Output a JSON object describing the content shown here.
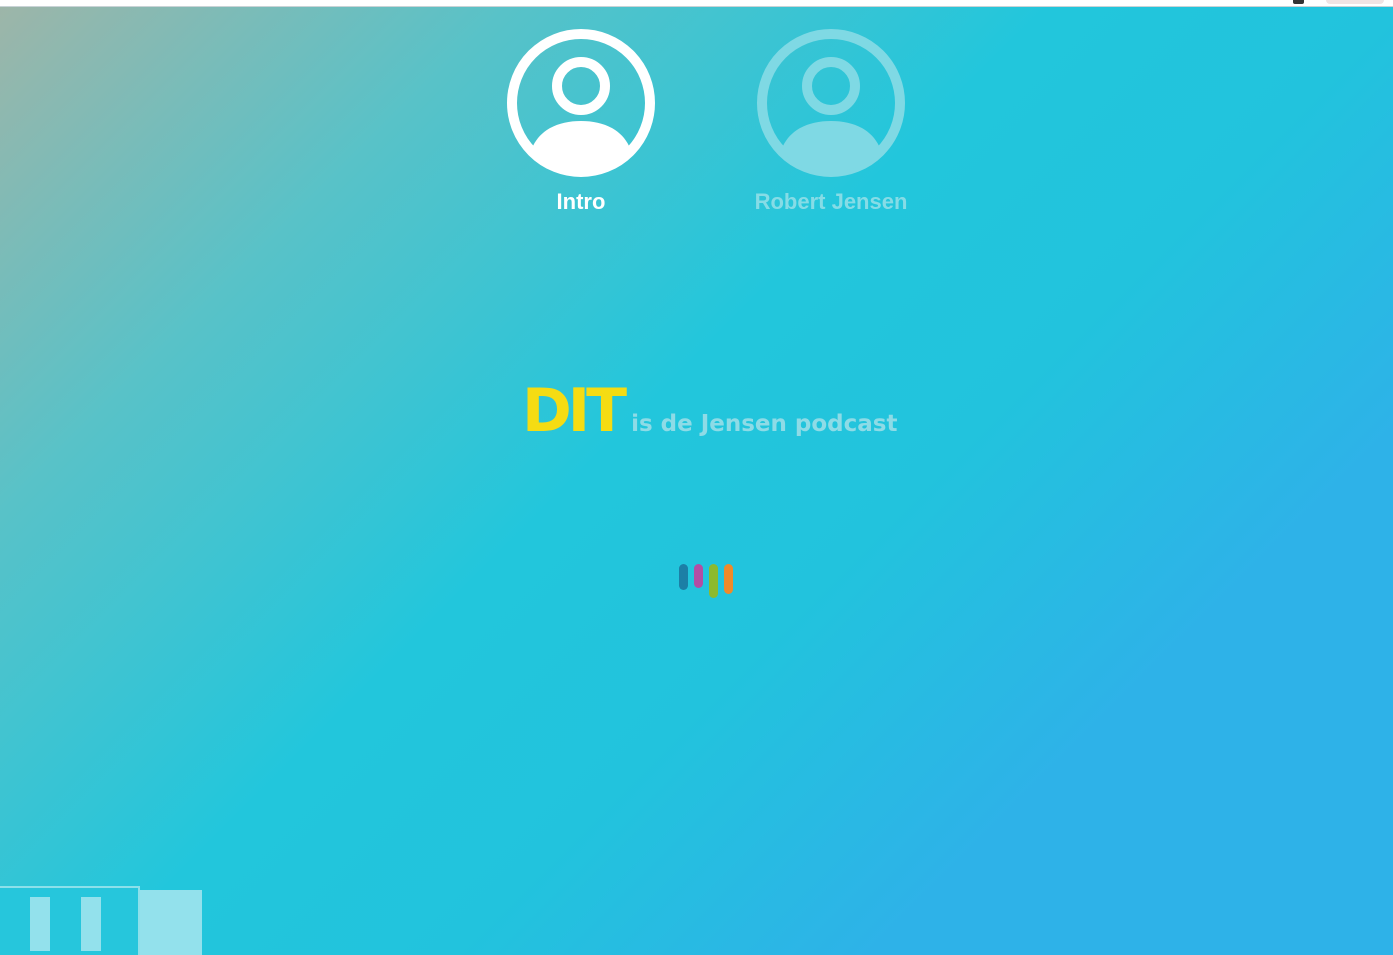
{
  "speakers": [
    {
      "label": "Intro",
      "icon": "user-circle-icon",
      "active": true,
      "color": "#ffffff"
    },
    {
      "label": "Robert Jensen",
      "icon": "user-circle-icon",
      "active": false,
      "color": "#86dce6"
    }
  ],
  "title": {
    "big": "DIT",
    "small": "is de Jensen podcast",
    "big_color": "#f5dc13",
    "small_color": "#8edbe6"
  },
  "loader": {
    "icon": "audio-wave-loader-icon",
    "colors": [
      "#1c7fa6",
      "#b24ea4",
      "#8dba2e",
      "#ef8a2a"
    ]
  },
  "player": {
    "icon": "pause-icon"
  },
  "colors": {
    "background_start": "#9eb5a8",
    "background_mid": "#22c6dc",
    "background_end": "#2eb2e8"
  }
}
